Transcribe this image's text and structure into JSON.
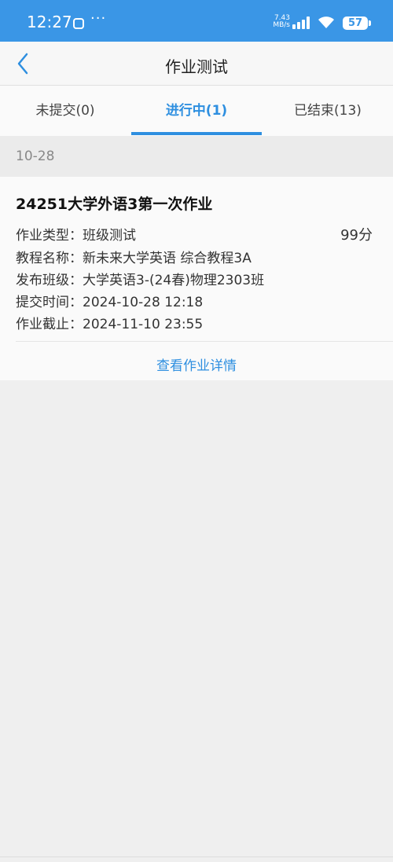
{
  "status_bar": {
    "time": "12:27",
    "dots": "···",
    "net_speed_value": "7.43",
    "net_speed_unit": "MB/s",
    "battery": "57"
  },
  "nav": {
    "title": "作业测试"
  },
  "tabs": [
    {
      "label": "未提交(0)",
      "active": false
    },
    {
      "label": "进行中(1)",
      "active": true
    },
    {
      "label": "已结束(13)",
      "active": false
    }
  ],
  "date_header": "10-28",
  "assignment": {
    "title": "24251大学外语3第一次作业",
    "score": "99分",
    "rows": [
      "作业类型：班级测试",
      "教程名称：新未来大学英语 综合教程3A",
      "发布班级：大学英语3-(24春)物理2303班",
      "提交时间：2024-10-28 12:18",
      "作业截止：2024-11-10 23:55"
    ],
    "detail_link": "查看作业详情"
  },
  "colors": {
    "status_bar": "#3a96e6",
    "accent": "#2e8fe0"
  }
}
